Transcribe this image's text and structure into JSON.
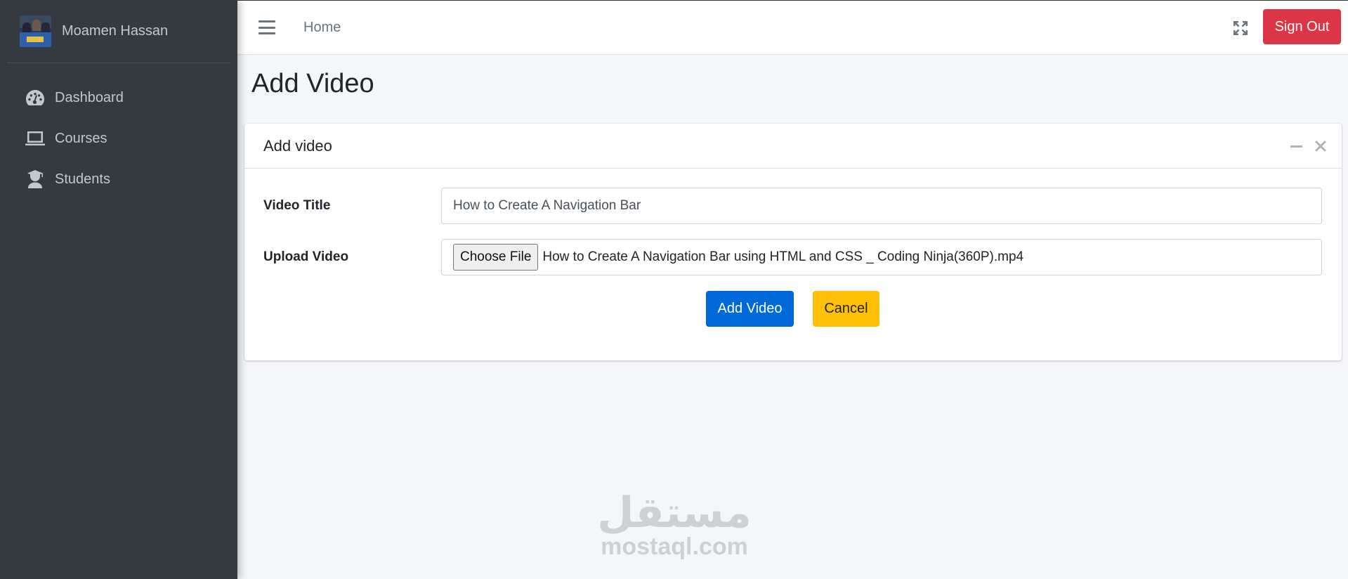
{
  "sidebar": {
    "user_name": "Moamen Hassan",
    "items": [
      {
        "label": "Dashboard",
        "icon": "tachometer-icon"
      },
      {
        "label": "Courses",
        "icon": "laptop-icon"
      },
      {
        "label": "Students",
        "icon": "user-graduate-icon"
      }
    ]
  },
  "navbar": {
    "home_label": "Home",
    "signout_label": "Sign Out"
  },
  "page": {
    "title": "Add Video"
  },
  "card": {
    "title": "Add video",
    "video_title_label": "Video Title",
    "video_title_value": "How to Create A Navigation Bar",
    "upload_label": "Upload Video",
    "choose_file_label": "Choose File",
    "file_name": "How to Create A Navigation Bar using HTML and CSS _ Coding Ninja(360P).mp4",
    "submit_label": "Add Video",
    "cancel_label": "Cancel"
  },
  "watermark": {
    "arabic": "مستقل",
    "latin": "mostaql.com"
  },
  "colors": {
    "sidebar_bg": "#343a40",
    "primary": "#0069d9",
    "danger": "#dc3545",
    "warning": "#ffc107"
  }
}
